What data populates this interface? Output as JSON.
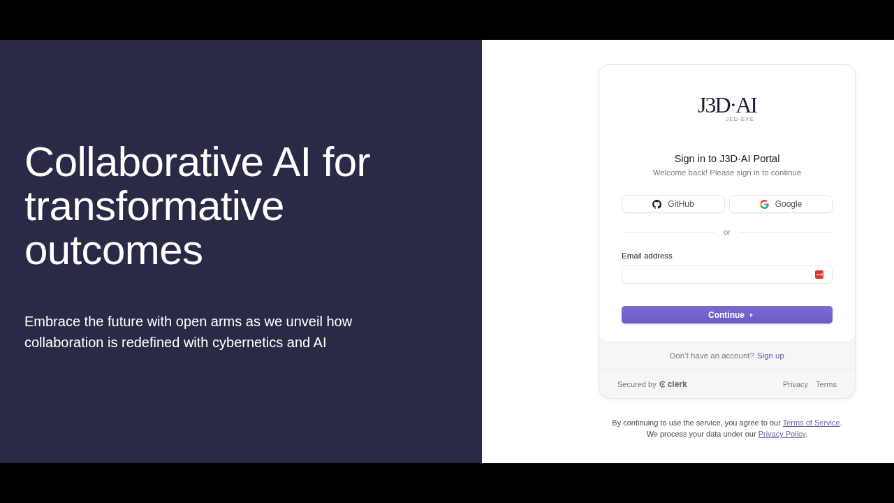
{
  "hero": {
    "heading": "Collaborative AI for transformative outcomes",
    "body": "Embrace the future with open arms as we unveil how collaboration is redefined with cybernetics and AI"
  },
  "card": {
    "logo": {
      "wordmark": "J3D·AI",
      "tagline": "JED-EYE"
    },
    "title": "Sign in to J3D·AI Portal",
    "subtitle": "Welcome back! Please sign in to continue",
    "social_buttons": [
      {
        "kind": "github",
        "label": "GitHub"
      },
      {
        "kind": "google",
        "label": "Google"
      }
    ],
    "divider": "or",
    "email": {
      "label": "Email address"
    },
    "continue_button": "Continue",
    "signup": {
      "prompt": "Don’t have an account?",
      "link": "Sign up"
    },
    "footer": {
      "secured_by": "Secured by",
      "brand": "clerk",
      "links": [
        "Privacy",
        "Terms"
      ]
    }
  },
  "legal": [
    {
      "before": "By continuing to use the service, you agree to our ",
      "link": "Terms of Service",
      "after": "."
    },
    {
      "before": "We process your data under our ",
      "link": "Privacy Policy",
      "after": "."
    }
  ]
}
